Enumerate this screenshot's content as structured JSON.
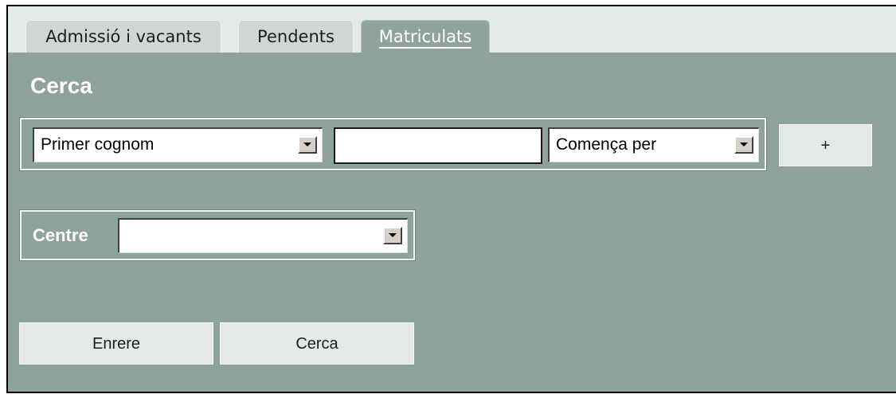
{
  "tabs": [
    {
      "label": "Admissió i vacants",
      "active": false
    },
    {
      "label": "Pendents",
      "active": false
    },
    {
      "label": "Matriculats",
      "active": true
    }
  ],
  "section": {
    "title": "Cerca"
  },
  "search_row": {
    "field_select": {
      "value": "Primer cognom"
    },
    "text_input": {
      "value": "",
      "placeholder": ""
    },
    "operator_select": {
      "value": "Comença per"
    },
    "add_button_label": "+"
  },
  "centre_filter": {
    "label": "Centre",
    "select_value": ""
  },
  "actions": {
    "back_label": "Enrere",
    "search_label": "Cerca"
  },
  "colors": {
    "panel_background": "#8fa39e",
    "tabbar_background": "#e3e9e8",
    "button_background": "#e3e9e8"
  },
  "icons": {
    "dropdown": "chevron-down-icon"
  }
}
